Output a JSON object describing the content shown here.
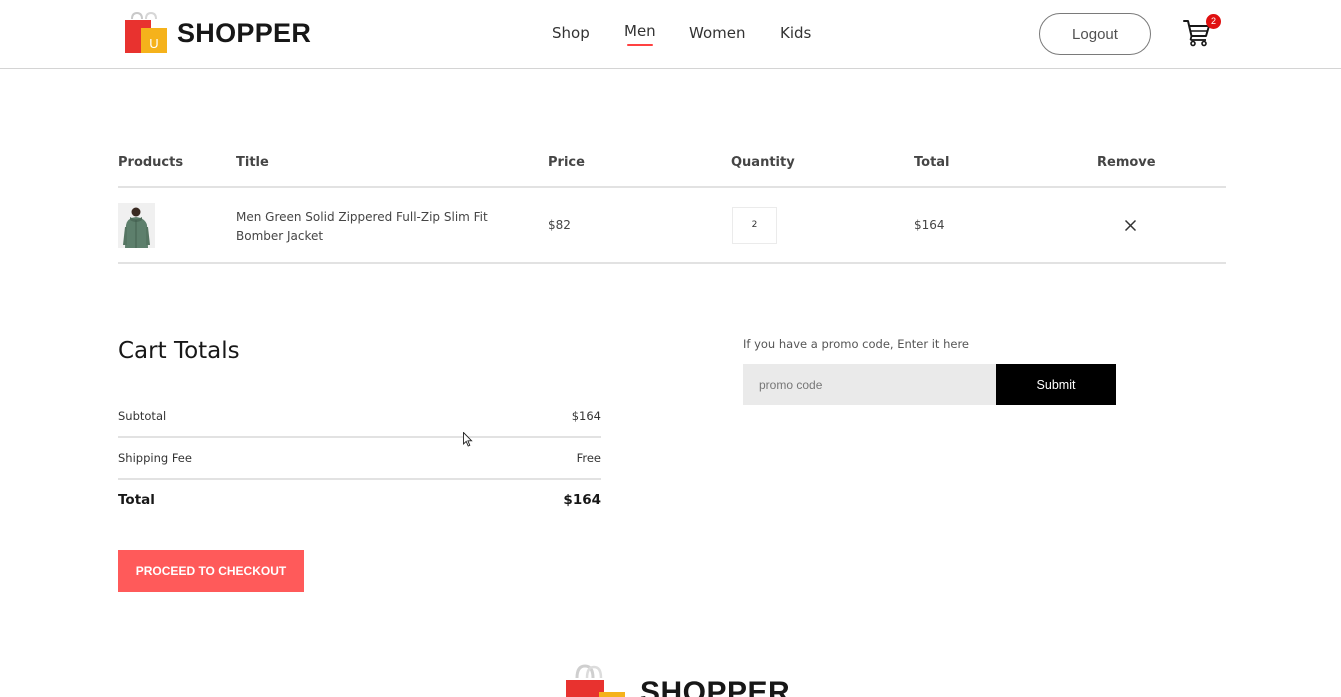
{
  "brand": {
    "name": "SHOPPER",
    "logo_letter": "U"
  },
  "nav": {
    "items": [
      {
        "label": "Shop",
        "active": false
      },
      {
        "label": "Men",
        "active": true
      },
      {
        "label": "Women",
        "active": false
      },
      {
        "label": "Kids",
        "active": false
      }
    ],
    "login_label": "Logout",
    "cart_count": "2"
  },
  "cart_table": {
    "headers": [
      "Products",
      "Title",
      "Price",
      "Quantity",
      "Total",
      "Remove"
    ],
    "rows": [
      {
        "title": "Men Green Solid Zippered Full-Zip Slim Fit Bomber Jacket",
        "price": "$82",
        "quantity": "2",
        "total": "$164"
      }
    ]
  },
  "cart_totals": {
    "heading": "Cart Totals",
    "subtotal_label": "Subtotal",
    "subtotal_value": "$164",
    "shipping_label": "Shipping Fee",
    "shipping_value": "Free",
    "total_label": "Total",
    "total_value": "$164",
    "checkout_label": "PROCEED TO CHECKOUT"
  },
  "promo": {
    "prompt": "If you have a promo code, Enter it here",
    "placeholder": "promo code",
    "submit_label": "Submit"
  },
  "footer": {
    "brand": "SHOPPER"
  },
  "colors": {
    "accent": "#ff4141",
    "checkout_button": "#ff5a5a",
    "promo_button": "#000000",
    "cart_badge": "#e01010"
  }
}
